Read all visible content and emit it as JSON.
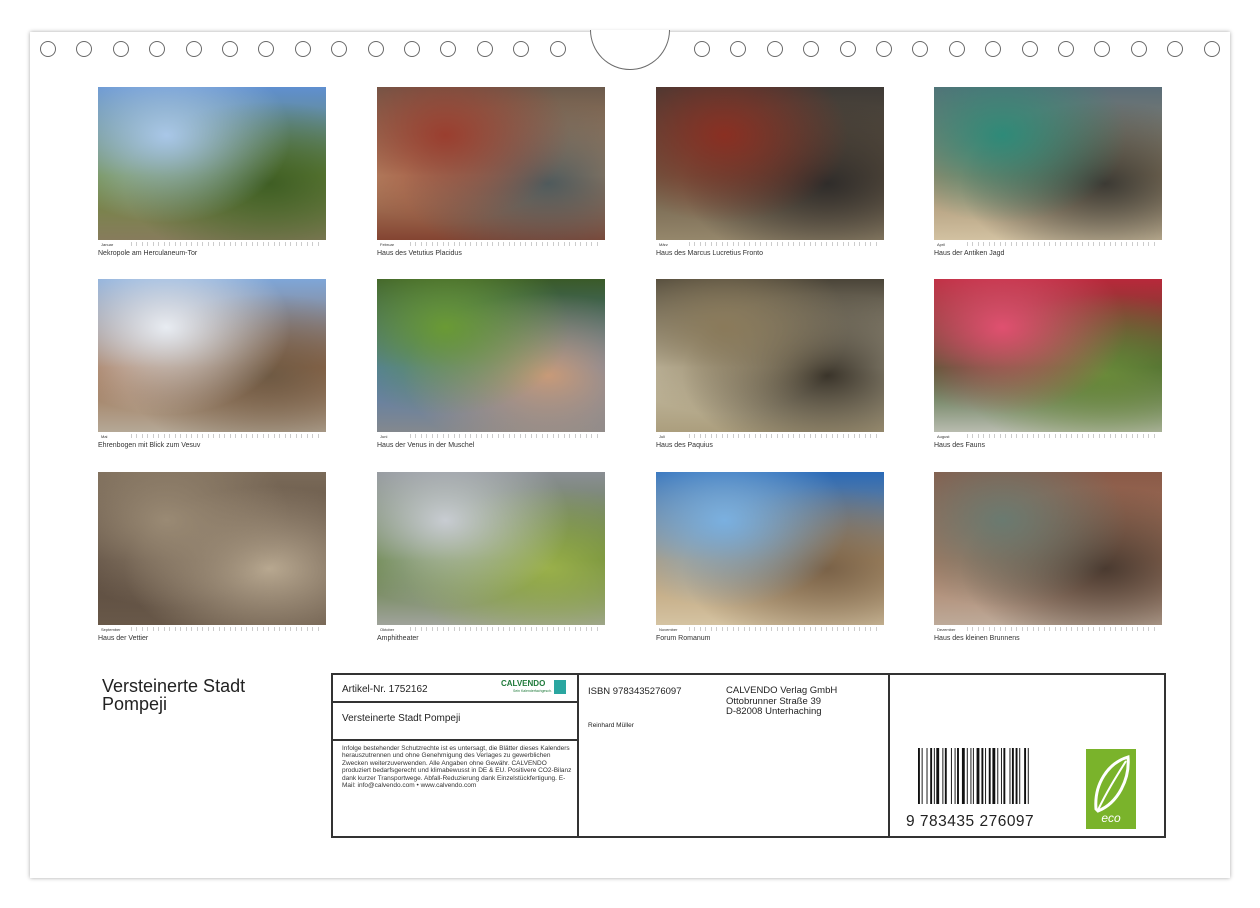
{
  "months": [
    {
      "label": "Januar",
      "caption": "Nekropole am Herculaneum-Tor"
    },
    {
      "label": "Februar",
      "caption": "Haus des Vetutius Placidus"
    },
    {
      "label": "März",
      "caption": "Haus des Marcus Lucretius Fronto"
    },
    {
      "label": "April",
      "caption": "Haus der Antiken Jagd"
    },
    {
      "label": "Mai",
      "caption": "Ehrenbogen mit Blick zum Vesuv"
    },
    {
      "label": "Juni",
      "caption": "Haus der Venus in der Muschel"
    },
    {
      "label": "Juli",
      "caption": "Haus des Paquius"
    },
    {
      "label": "August",
      "caption": "Haus des Fauns"
    },
    {
      "label": "September",
      "caption": "Haus der Vettier"
    },
    {
      "label": "Oktober",
      "caption": "Amphitheater"
    },
    {
      "label": "November",
      "caption": "Forum Romanum"
    },
    {
      "label": "Dezember",
      "caption": "Haus des kleinen Brunnens"
    }
  ],
  "title": {
    "line1": "Versteinerte Stadt",
    "line2": "Pompeji"
  },
  "info": {
    "article": "Artikel-Nr. 1752162",
    "brand": "CALVENDO",
    "brand_sub": "Sein Kalenderfachgesch.",
    "product_title": "Versteinerte Stadt Pompeji",
    "legal": "Infolge bestehender Schutzrechte ist es untersagt, die Blätter dieses Kalenders herauszutrennen und ohne Genehmigung des Verlages zu gewerblichen Zwecken weiterzuverwenden. Alle Angaben ohne Gewähr. CALVENDO produziert bedarfsgerecht und klimabewusst in DE & EU. Positivere CO2-Bilanz dank kurzer Transportwege. Abfall-Reduzierung dank Einzelstückfertigung. E-Mail: info@calvendo.com • www.calvendo.com",
    "isbn": "ISBN 9783435276097",
    "author": "Reinhard Müller",
    "publisher1": "CALVENDO Verlag GmbH",
    "publisher2": "Ottobrunner Straße 39",
    "publisher3": "D-82008 Unterhaching",
    "barcode_digits": "9 783435 276097",
    "eco": "eco"
  }
}
